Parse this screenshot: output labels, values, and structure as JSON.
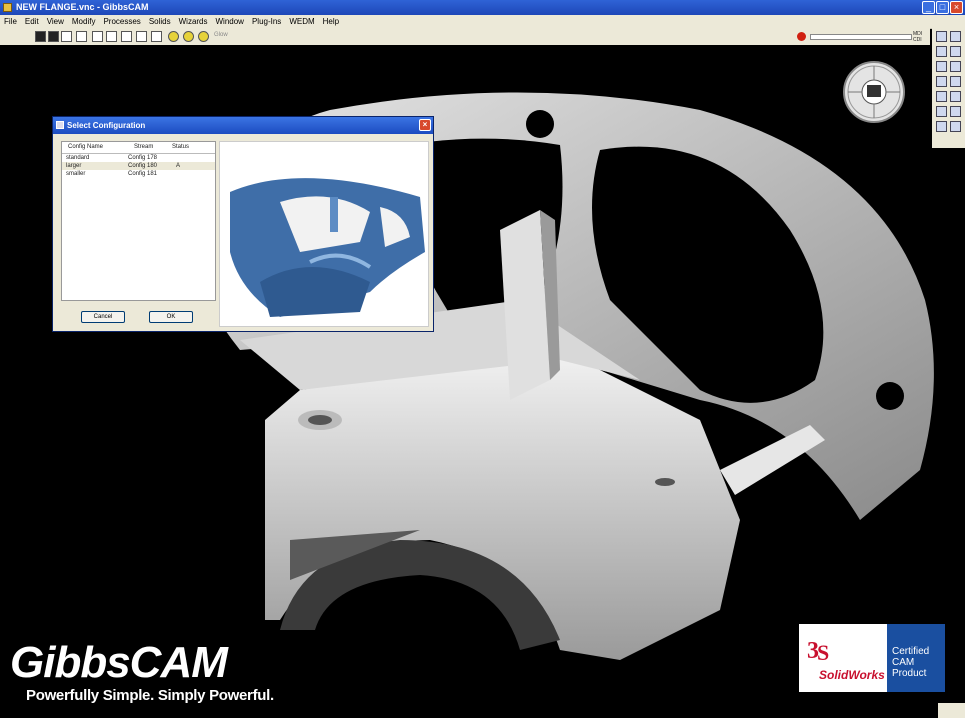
{
  "window": {
    "title": "NEW FLANGE.vnc - GibbsCAM"
  },
  "menu": [
    "File",
    "Edit",
    "View",
    "Modify",
    "Processes",
    "Solids",
    "Wizards",
    "Window",
    "Plug-Ins",
    "WEDM",
    "Help"
  ],
  "toolbar": {
    "label": "Glow"
  },
  "mdi": {
    "line1": "MDI",
    "line2": "CDI"
  },
  "dialog": {
    "title": "Select Configuration",
    "columns": [
      "Config Name",
      "Stream",
      "Status"
    ],
    "rows": [
      {
        "name": "standard",
        "stream": "Config 178",
        "status": ""
      },
      {
        "name": "larger",
        "stream": "Config 180",
        "status": "A"
      },
      {
        "name": "smaller",
        "stream": "Config 181",
        "status": ""
      }
    ],
    "cancel_label": "Cancel",
    "ok_label": "OK"
  },
  "branding": {
    "logo": "GibbsCAM",
    "tagline": "Powerfully Simple. Simply Powerful.",
    "badge_brand": "SolidWorks",
    "badge_text": "Certified CAM Product"
  },
  "colors": {
    "titlebar": "#1d47b8",
    "part": "#c8c8c8",
    "background": "#000000"
  }
}
